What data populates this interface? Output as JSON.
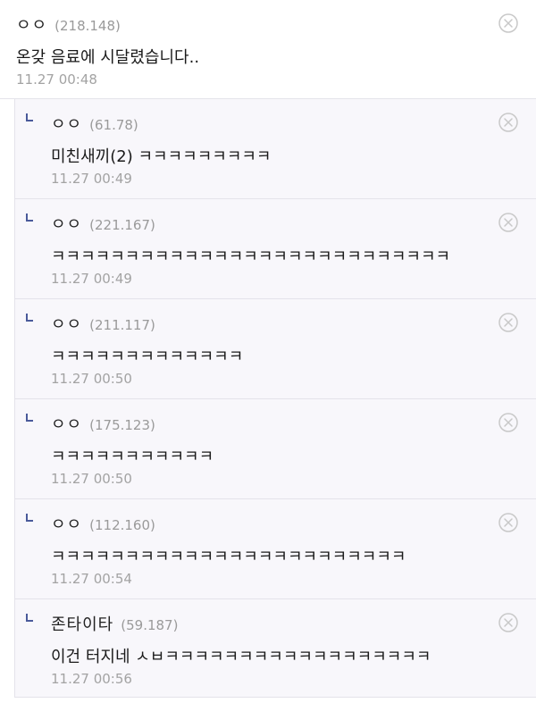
{
  "comments": [
    {
      "nick": "ㅇㅇ",
      "ip": "(218.148)",
      "text": "온갖 음료에 시달렸습니다..",
      "time": "11.27 00:48"
    }
  ],
  "replies": [
    {
      "nick": "ㅇㅇ",
      "ip": "(61.78)",
      "text": "미친새끼(2) ㅋㅋㅋㅋㅋㅋㅋㅋㅋ",
      "time": "11.27 00:49"
    },
    {
      "nick": "ㅇㅇ",
      "ip": "(221.167)",
      "text": "ㅋㅋㅋㅋㅋㅋㅋㅋㅋㅋㅋㅋㅋㅋㅋㅋㅋㅋㅋㅋㅋㅋㅋㅋㅋㅋㅋ",
      "time": "11.27 00:49"
    },
    {
      "nick": "ㅇㅇ",
      "ip": "(211.117)",
      "text": "ㅋㅋㅋㅋㅋㅋㅋㅋㅋㅋㅋㅋㅋ",
      "time": "11.27 00:50"
    },
    {
      "nick": "ㅇㅇ",
      "ip": "(175.123)",
      "text": "ㅋㅋㅋㅋㅋㅋㅋㅋㅋㅋㅋ",
      "time": "11.27 00:50"
    },
    {
      "nick": "ㅇㅇ",
      "ip": "(112.160)",
      "text": "ㅋㅋㅋㅋㅋㅋㅋㅋㅋㅋㅋㅋㅋㅋㅋㅋㅋㅋㅋㅋㅋㅋㅋㅋ",
      "time": "11.27 00:54"
    },
    {
      "nick": "존타이타",
      "ip": "(59.187)",
      "text": "이건 터지네 ㅅㅂㅋㅋㅋㅋㅋㅋㅋㅋㅋㅋㅋㅋㅋㅋㅋㅋㅋㅋ",
      "time": "11.27 00:56"
    }
  ],
  "icons": {
    "delete": "close-circle-icon",
    "reply_marker": "reply-arrow-icon"
  },
  "colors": {
    "reply_marker": "#4a5a9a",
    "delete_icon": "#c8c8c8"
  }
}
